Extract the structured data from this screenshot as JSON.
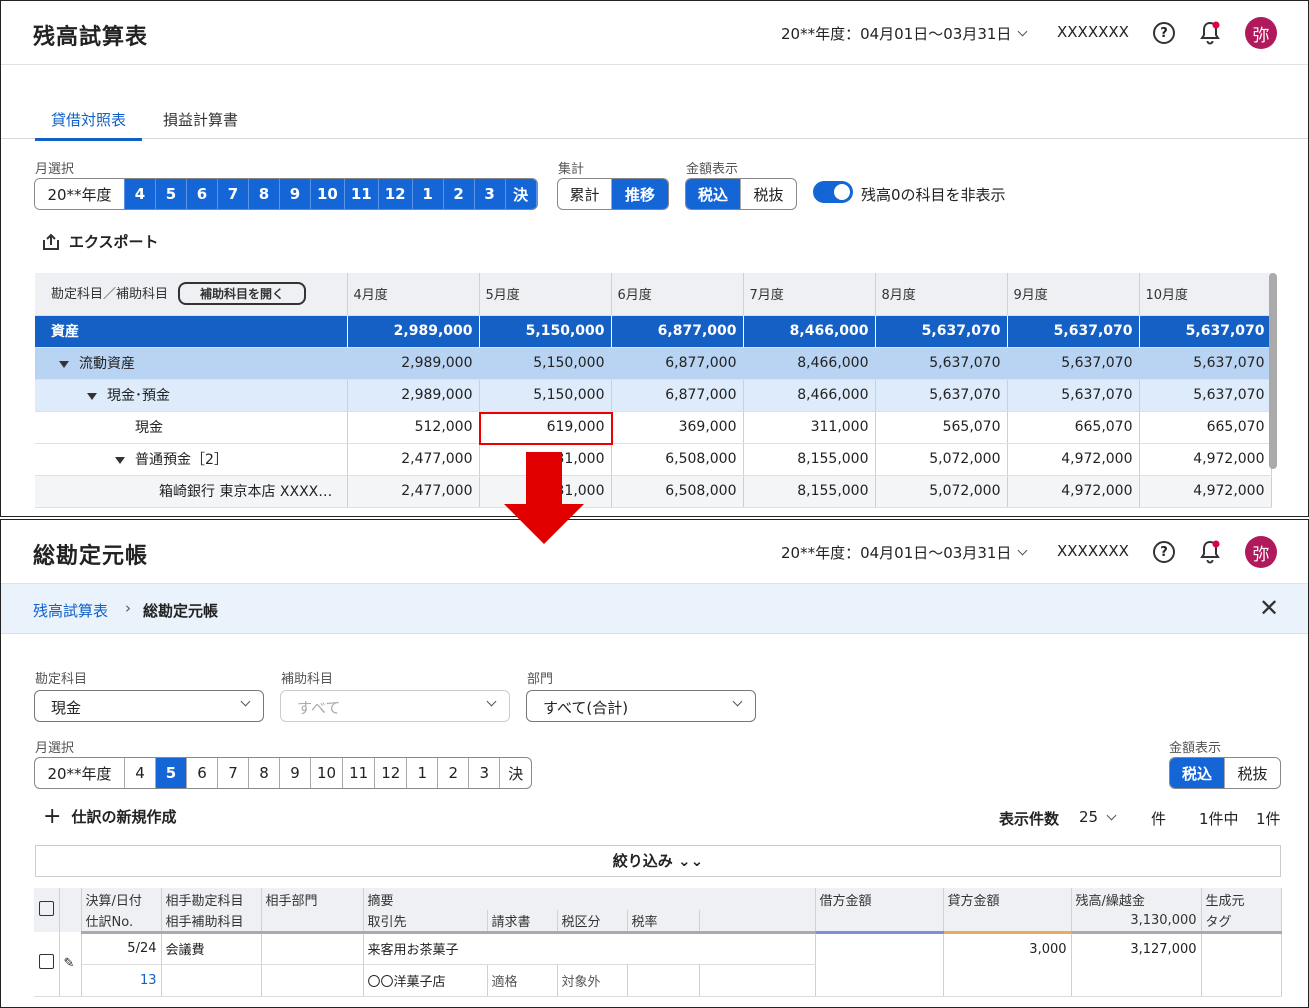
{
  "header": {
    "fiscal": "20**年度：04月01日～03月31日",
    "user": "XXXXXXX",
    "help": "?",
    "avatar": "弥"
  },
  "trial": {
    "title": "残高試算表",
    "tabs": [
      "貸借対照表",
      "損益計算書"
    ],
    "month_label": "月選択",
    "months": [
      "20**年度",
      "4",
      "5",
      "6",
      "7",
      "8",
      "9",
      "10",
      "11",
      "12",
      "1",
      "2",
      "3",
      "決"
    ],
    "agg_label": "集計",
    "agg": [
      "累計",
      "推移"
    ],
    "amount_label": "金額表示",
    "amount": [
      "税込",
      "税抜"
    ],
    "hide_zero": "残高0の科目を非表示",
    "export": "エクスポート",
    "col_account": "勘定科目／補助科目",
    "open_sub": "補助科目を開く",
    "columns": [
      "4月度",
      "5月度",
      "6月度",
      "7月度",
      "8月度",
      "9月度",
      "10月度"
    ],
    "rows": [
      {
        "label": "資産",
        "values": [
          "2,989,000",
          "5,150,000",
          "6,877,000",
          "8,466,000",
          "5,637,070",
          "5,637,070",
          "5,637,070"
        ]
      },
      {
        "label": "流動資産",
        "values": [
          "2,989,000",
          "5,150,000",
          "6,877,000",
          "8,466,000",
          "5,637,070",
          "5,637,070",
          "5,637,070"
        ]
      },
      {
        "label": "現金･預金",
        "values": [
          "2,989,000",
          "5,150,000",
          "6,877,000",
          "8,466,000",
          "5,637,070",
          "5,637,070",
          "5,637,070"
        ]
      },
      {
        "label": "現金",
        "values": [
          "512,000",
          "619,000",
          "369,000",
          "311,000",
          "565,070",
          "665,070",
          "665,070"
        ]
      },
      {
        "label": "普通預金［2］",
        "values": [
          "2,477,000",
          "31,000",
          "6,508,000",
          "8,155,000",
          "5,072,000",
          "4,972,000",
          "4,972,000"
        ]
      },
      {
        "label": "箱崎銀行 東京本店 XXXX…",
        "values": [
          "2,477,000",
          "31,000",
          "6,508,000",
          "8,155,000",
          "5,072,000",
          "4,972,000",
          "4,972,000"
        ]
      }
    ]
  },
  "ledger": {
    "title": "総勘定元帳",
    "breadcrumb_parent": "残高試算表",
    "breadcrumb_current": "総勘定元帳",
    "account_label": "勘定科目",
    "account_value": "現金",
    "sub_label": "補助科目",
    "sub_value": "すべて",
    "dept_label": "部門",
    "dept_value": "すべて(合計)",
    "month_label": "月選択",
    "months": [
      "20**年度",
      "4",
      "5",
      "6",
      "7",
      "8",
      "9",
      "10",
      "11",
      "12",
      "1",
      "2",
      "3",
      "決"
    ],
    "amount_label": "金額表示",
    "amount": [
      "税込",
      "税抜"
    ],
    "new_entry": "仕訳の新規作成",
    "display_count_label": "表示件数",
    "display_count": "25",
    "count_unit": "件",
    "count_summary": "1件中",
    "count_total": "1件",
    "filter": "絞り込み",
    "head1": [
      "決算/日付",
      "相手勘定科目",
      "相手部門",
      "摘要",
      "借方金額",
      "貸方金額",
      "残高/繰越金",
      "生成元"
    ],
    "head2": [
      "仕訳No.",
      "相手補助科目",
      "取引先",
      "請求書",
      "税区分",
      "税率",
      "3,130,000",
      "タグ"
    ],
    "row": {
      "date": "5/24",
      "account": "会議費",
      "memo": "来客用お茶菓子",
      "credit": "3,000",
      "balance": "3,127,000",
      "no": "13",
      "partner": "〇〇洋菓子店",
      "invoice": "適格",
      "tax": "対象外"
    }
  },
  "colors": {
    "accent": "#1466d6",
    "highlight": "#e00000",
    "avatar": "#b0195c"
  }
}
